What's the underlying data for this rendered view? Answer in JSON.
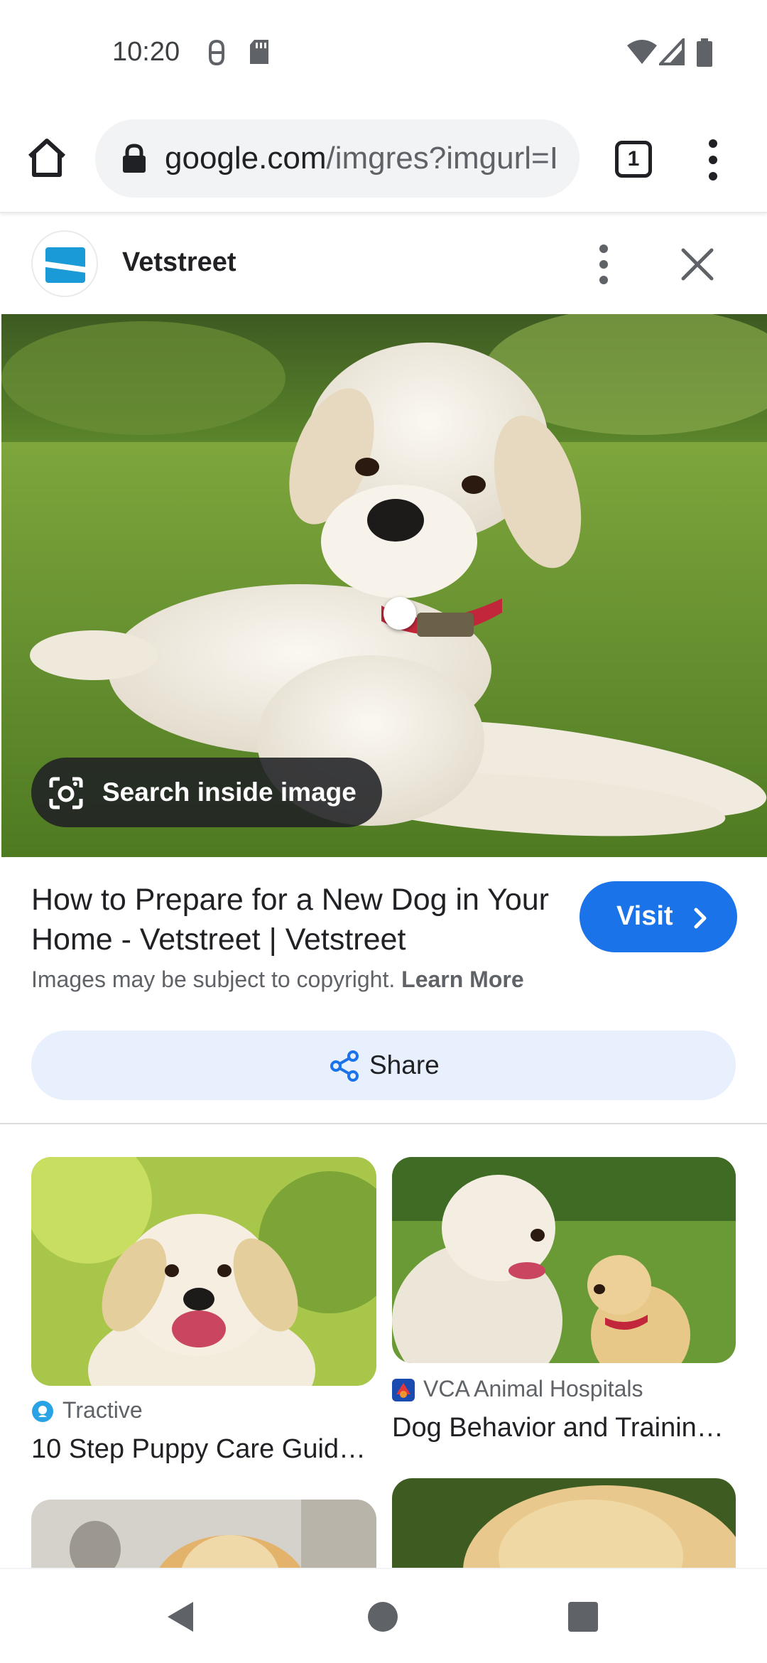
{
  "status_bar": {
    "time": "10:20"
  },
  "toolbar": {
    "url_domain": "google.com",
    "url_path": "/imgres?imgurl=I",
    "tab_count": "1"
  },
  "source_header": {
    "site_name": "Vetstreet"
  },
  "main_image": {
    "alt_subject": "puppy",
    "lens_chip_label": "Search inside image"
  },
  "result": {
    "title": "How to Prepare for a New Dog in Your Home - Vetstreet | Vetstreet",
    "visit_label": "Visit",
    "copyright_text": "Images may be subject to copyright.",
    "learn_more": "Learn More",
    "share_label": "Share"
  },
  "related": [
    {
      "source": "Tractive",
      "title": "10 Step Puppy Care Guid…",
      "source_icon": "tractive-icon"
    },
    {
      "source": "VCA Animal Hospitals",
      "title": "Dog Behavior and Trainin…",
      "source_icon": "vca-icon"
    }
  ],
  "colors": {
    "accent": "#1a73e8",
    "share_bg": "#e8f0fe",
    "chip_bg": "#202124"
  }
}
